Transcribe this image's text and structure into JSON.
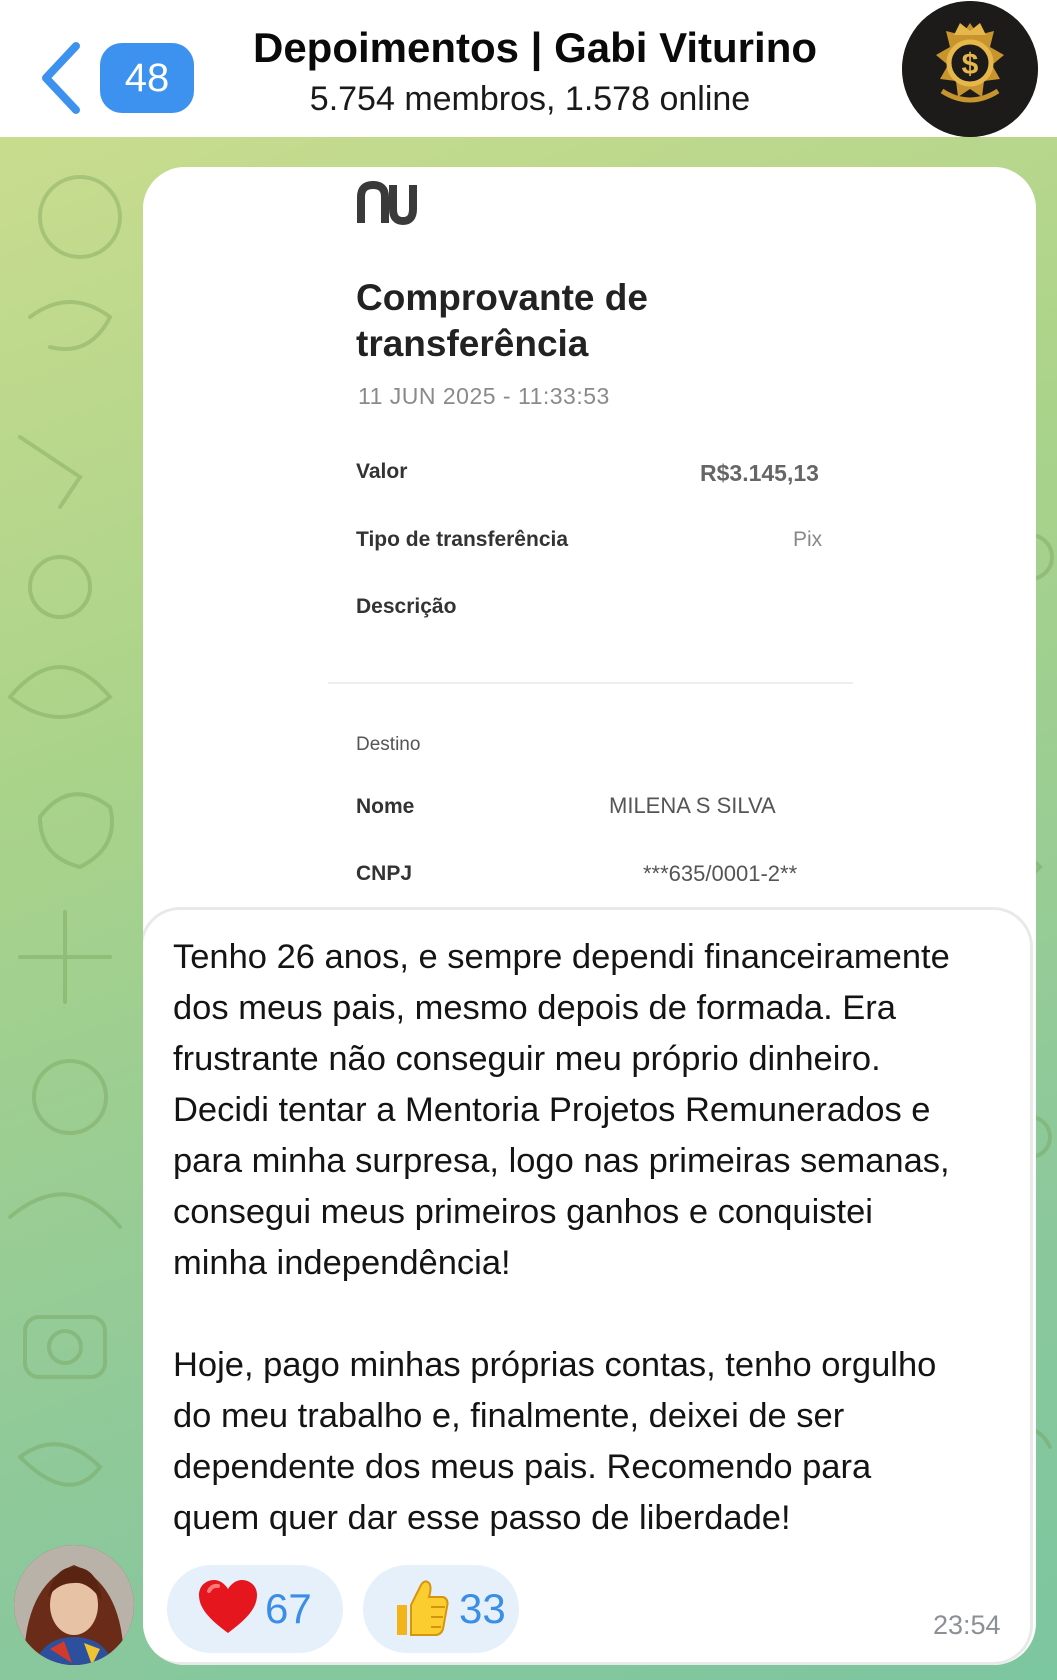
{
  "header": {
    "unread_count": "48",
    "title": "Depoimentos | Gabi Viturino",
    "subtitle": "5.754 membros, 1.578 online",
    "back_icon": "chevron-left-icon",
    "accent_color": "#3d92f0"
  },
  "message": {
    "receipt": {
      "title": "Comprovante de transferência",
      "date": "11 JUN 2025 - 11:33:53",
      "rows": [
        {
          "label": "Valor",
          "value": "R$3.145,13"
        },
        {
          "label": "Tipo de transferência",
          "value": "Pix"
        },
        {
          "label": "Descrição",
          "value": ""
        }
      ],
      "destination_section": "Destino",
      "destination_rows": [
        {
          "label": "Nome",
          "value": "MILENA S SILVA"
        },
        {
          "label": "CNPJ",
          "value": "***635/0001-2**"
        }
      ]
    },
    "caption": "Tenho 26 anos, e sempre dependi financeiramente\ndos meus pais, mesmo depois de formada. Era\nfrustrante não conseguir meu próprio dinheiro.\nDecidi tentar a Mentoria Projetos Remunerados e\npara minha surpresa, logo nas primeiras semanas,\nconsegui meus primeiros ganhos e conquistei\nminha independência!\n\nHoje, pago minhas próprias contas, tenho orgulho\ndo meu trabalho e, finalmente, deixei de ser\ndependente dos meus pais. Recomendo para\nquem quer dar esse passo de liberdade!",
    "reactions": [
      {
        "icon": "red-heart-icon",
        "count": "67"
      },
      {
        "icon": "thumbs-up-icon",
        "count": "33"
      }
    ],
    "time": "23:54"
  }
}
